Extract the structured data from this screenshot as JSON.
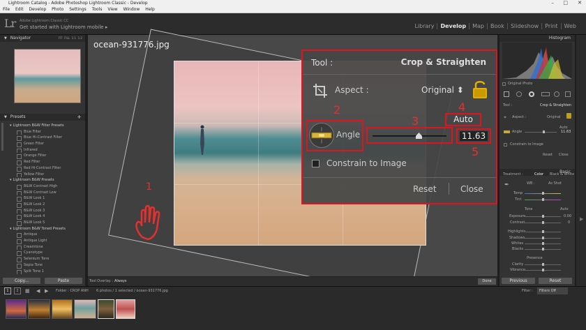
{
  "window": {
    "title": "Lightroom Catalog - Adobe Photoshop Lightroom Classic - Develop"
  },
  "menu": [
    "File",
    "Edit",
    "Develop",
    "Photo",
    "Settings",
    "Tools",
    "View",
    "Window",
    "Help"
  ],
  "identity": {
    "logo": "Lr",
    "product": "Adobe Lightroom Classic CC",
    "subtitle": "Get started with Lightroom mobile  ▸"
  },
  "modules": [
    "Library",
    "Develop",
    "Map",
    "Book",
    "Slideshow",
    "Print",
    "Web"
  ],
  "left_panel": {
    "navigator_title": "Navigator",
    "navigator_zoom": [
      "FIT",
      "FILL",
      "1:1",
      "1:2"
    ],
    "presets_title": "Presets",
    "presets": [
      {
        "type": "folder",
        "label": "Lightroom B&W Filter Presets"
      },
      {
        "type": "item",
        "label": "Blue Filter"
      },
      {
        "type": "item",
        "label": "Blue Hi-Contrast Filter"
      },
      {
        "type": "item",
        "label": "Green Filter"
      },
      {
        "type": "item",
        "label": "Infrared"
      },
      {
        "type": "item",
        "label": "Orange Filter"
      },
      {
        "type": "item",
        "label": "Red Filter"
      },
      {
        "type": "item",
        "label": "Red Hi-Contrast Filter"
      },
      {
        "type": "item",
        "label": "Yellow Filter"
      },
      {
        "type": "folder",
        "label": "Lightroom B&W Presets"
      },
      {
        "type": "item",
        "label": "B&W Contrast High"
      },
      {
        "type": "item",
        "label": "B&W Contrast Low"
      },
      {
        "type": "item",
        "label": "B&W Look 1"
      },
      {
        "type": "item",
        "label": "B&W Look 2"
      },
      {
        "type": "item",
        "label": "B&W Look 3"
      },
      {
        "type": "item",
        "label": "B&W Look 4"
      },
      {
        "type": "item",
        "label": "B&W Look 5"
      },
      {
        "type": "folder",
        "label": "Lightroom B&W Toned Presets"
      },
      {
        "type": "item",
        "label": "Antique"
      },
      {
        "type": "item",
        "label": "Antique Light"
      },
      {
        "type": "item",
        "label": "Creamtone"
      },
      {
        "type": "item",
        "label": "Cyanotype"
      },
      {
        "type": "item",
        "label": "Selenium Tone"
      },
      {
        "type": "item",
        "label": "Sepia Tone"
      },
      {
        "type": "item",
        "label": "Split Tone 1"
      }
    ],
    "copy_label": "Copy...",
    "paste_label": "Paste"
  },
  "canvas": {
    "filename": "ocean-931776.jpg"
  },
  "annotations": {
    "n1": "1",
    "n2": "2",
    "n3": "3",
    "n4": "4",
    "n5": "5"
  },
  "crop_tool": {
    "tool_label": "Tool :",
    "tool_name": "Crop & Straighten",
    "aspect_label": "Aspect :",
    "aspect_value": "Original ⬍",
    "angle_label": "Angle",
    "angle_slider_fraction": 0.62,
    "auto_label": "Auto",
    "angle_value": "11.63",
    "constrain_label": "Constrain to Image",
    "reset_label": "Reset",
    "close_label": "Close"
  },
  "toolbar": {
    "overlay_label": "Tool Overlay :",
    "overlay_value": "Always",
    "done_label": "Done"
  },
  "right_panel": {
    "histogram_title": "Histogram",
    "original_photo": "Original Photo",
    "tool_label": "Tool :",
    "tool_name": "Crop & Straighten",
    "aspect_label": "Aspect :",
    "aspect_value": "Original",
    "auto_label": "Auto",
    "angle_label": "Angle",
    "angle_value": "11.63",
    "constrain_label": "Constrain to Image",
    "reset_label": "Reset",
    "close_label": "Close",
    "basic_title": "Basic",
    "treatment_label": "Treatment :",
    "color_label": "Color",
    "bw_label": "Black & White",
    "wb_label": "WB :",
    "wb_value": "As Shot",
    "temp_label": "Temp",
    "tint_label": "Tint",
    "tone_label": "Tone",
    "tone_auto": "Auto",
    "exposure_label": "Exposure",
    "exposure_value": "0.00",
    "contrast_label": "Contrast",
    "contrast_value": "0",
    "highlights_label": "Highlights",
    "shadows_label": "Shadows",
    "whites_label": "Whites",
    "blacks_label": "Blacks",
    "presence_label": "Presence",
    "clarity_label": "Clarity",
    "vibrance_label": "Vibrance",
    "previous_label": "Previous",
    "reset_btn_label": "Reset"
  },
  "bottom": {
    "pages": [
      "1",
      "2"
    ],
    "folder_path": "Folder : CROP ANH",
    "status": "6 photos / 1 selected / ocean-931776.jpg",
    "filter_label": "Filter :",
    "filter_value": "Filters Off"
  }
}
